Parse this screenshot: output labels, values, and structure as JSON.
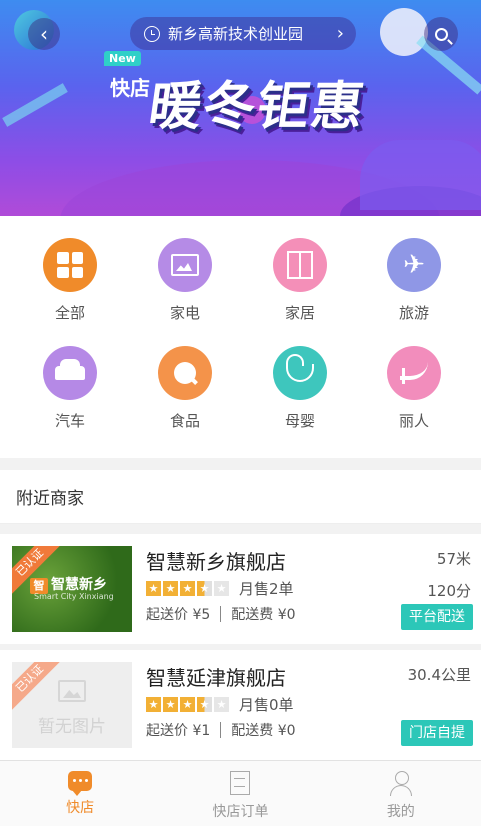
{
  "header": {
    "location": "新乡高新技术创业园",
    "back_icon": "back-icon",
    "search_icon": "search-icon"
  },
  "banner": {
    "new_tag": "New",
    "brand": "快店",
    "promo": "暖冬钜惠"
  },
  "categories": [
    {
      "label": "全部",
      "icon": "grid-icon",
      "color": "#f08b2a"
    },
    {
      "label": "家电",
      "icon": "tv-icon",
      "color": "#b58be6"
    },
    {
      "label": "家居",
      "icon": "wardrobe-icon",
      "color": "#f48fb8"
    },
    {
      "label": "旅游",
      "icon": "plane-globe-icon",
      "color": "#8f97e6"
    },
    {
      "label": "汽车",
      "icon": "car-icon",
      "color": "#b589e6"
    },
    {
      "label": "食品",
      "icon": "food-icon",
      "color": "#f4934a"
    },
    {
      "label": "母婴",
      "icon": "stroller-icon",
      "color": "#3ec6bd"
    },
    {
      "label": "丽人",
      "icon": "high-heel-icon",
      "color": "#f28dbc"
    }
  ],
  "nearby": {
    "title": "附近商家",
    "stores": [
      {
        "name": "智慧新乡旗舰店",
        "distance": "57米",
        "rating": 3.5,
        "monthly_sales": "月售2单",
        "score": "120分",
        "min_order": "起送价 ¥5",
        "delivery_fee": "配送费 ¥0",
        "delivery_type": "平台配送",
        "verified": "已认证",
        "image_text": "智慧新乡",
        "image_subtext": "Smart City Xinxiang",
        "has_image": true
      },
      {
        "name": "智慧延津旗舰店",
        "distance": "30.4公里",
        "rating": 3.5,
        "monthly_sales": "月售0单",
        "score": "",
        "min_order": "起送价 ¥1",
        "delivery_fee": "配送费 ¥0",
        "delivery_type": "门店自提",
        "verified": "已认证",
        "image_text": "暂无图片",
        "has_image": false
      }
    ]
  },
  "bottom_nav": [
    {
      "label": "快店",
      "icon": "chat-bubble-icon",
      "active": true
    },
    {
      "label": "快店订单",
      "icon": "order-list-icon",
      "active": false
    },
    {
      "label": "我的",
      "icon": "user-icon",
      "active": false
    }
  ],
  "colors": {
    "accent": "#f08b2a",
    "teal": "#2cc7b8",
    "star": "#f2b035"
  }
}
